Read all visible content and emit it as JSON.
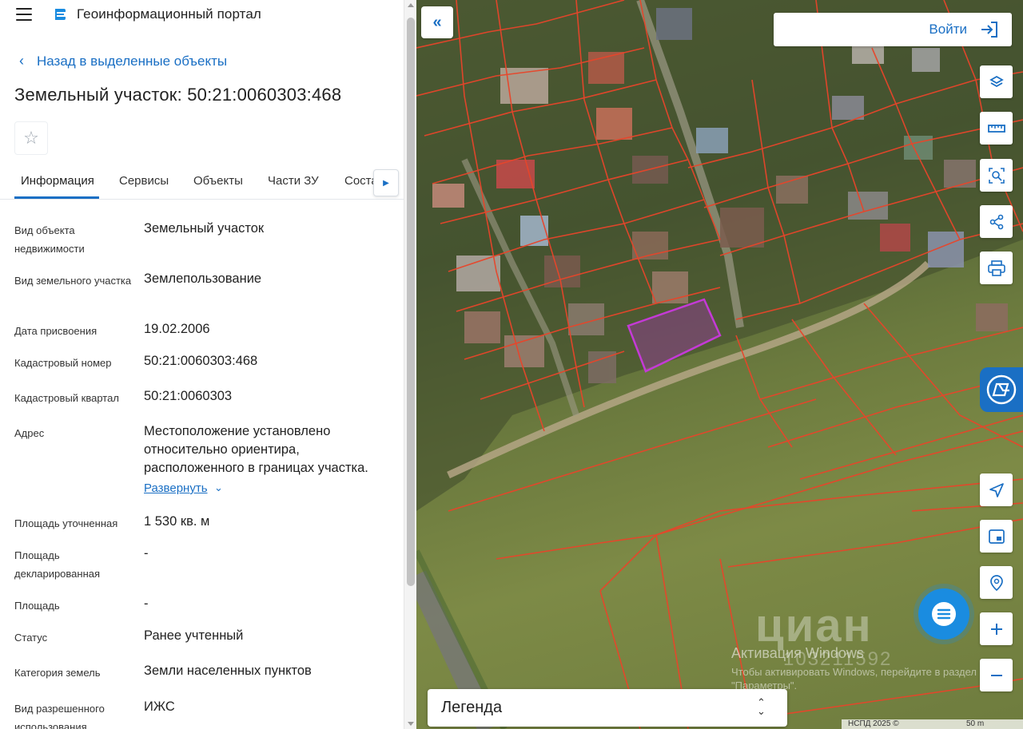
{
  "header": {
    "app_title": "Геоинформационный портал"
  },
  "nav": {
    "back_label": "Назад в выделенные объекты"
  },
  "object": {
    "title": "Земельный участок: 50:21:0060303:468"
  },
  "tabs": [
    {
      "label": "Информация"
    },
    {
      "label": "Сервисы"
    },
    {
      "label": "Объекты"
    },
    {
      "label": "Части ЗУ"
    },
    {
      "label": "Соста"
    }
  ],
  "details": [
    {
      "label": "Вид объекта недвижимости",
      "value": "Земельный участок"
    },
    {
      "label": "Вид земельного участка",
      "value": "Землепользование"
    },
    {
      "label": "Дата присвоения",
      "value": "19.02.2006"
    },
    {
      "label": "Кадастровый номер",
      "value": "50:21:0060303:468"
    },
    {
      "label": "Кадастровый квартал",
      "value": "50:21:0060303"
    },
    {
      "label": "Адрес",
      "value": "Местоположение установлено относительно ориентира, расположенного в границах участка."
    },
    {
      "label": "Площадь уточненная",
      "value": "1 530 кв. м"
    },
    {
      "label": "Площадь декларированная",
      "value": "-"
    },
    {
      "label": "Площадь",
      "value": "-"
    },
    {
      "label": "Статус",
      "value": "Ранее учтенный"
    },
    {
      "label": "Категория земель",
      "value": "Земли населенных пунктов"
    },
    {
      "label": "Вид разрешенного использования",
      "value": "ИЖС"
    }
  ],
  "expand_label": "Развернуть",
  "map": {
    "login_label": "Войти",
    "legend_label": "Легенда",
    "copyright": "НСПД 2025 ©",
    "scale_label": "50 m",
    "tools": [
      "layers-icon",
      "ruler-icon",
      "search-area-icon",
      "share-icon",
      "print-icon",
      "location-icon",
      "minimap-icon",
      "pin-search-icon",
      "zoom-in-icon",
      "zoom-out-icon"
    ]
  },
  "watermark": {
    "activation_title": "Активация Windows",
    "activation_text": "Чтобы активировать Windows, перейдите в раздел \"Параметры\".",
    "cian": "циан",
    "cian_number": "103211592"
  },
  "colors": {
    "accent": "#1a6fc4",
    "parcel_line": "#e8452a",
    "selected_parcel": "#b02fc0"
  }
}
